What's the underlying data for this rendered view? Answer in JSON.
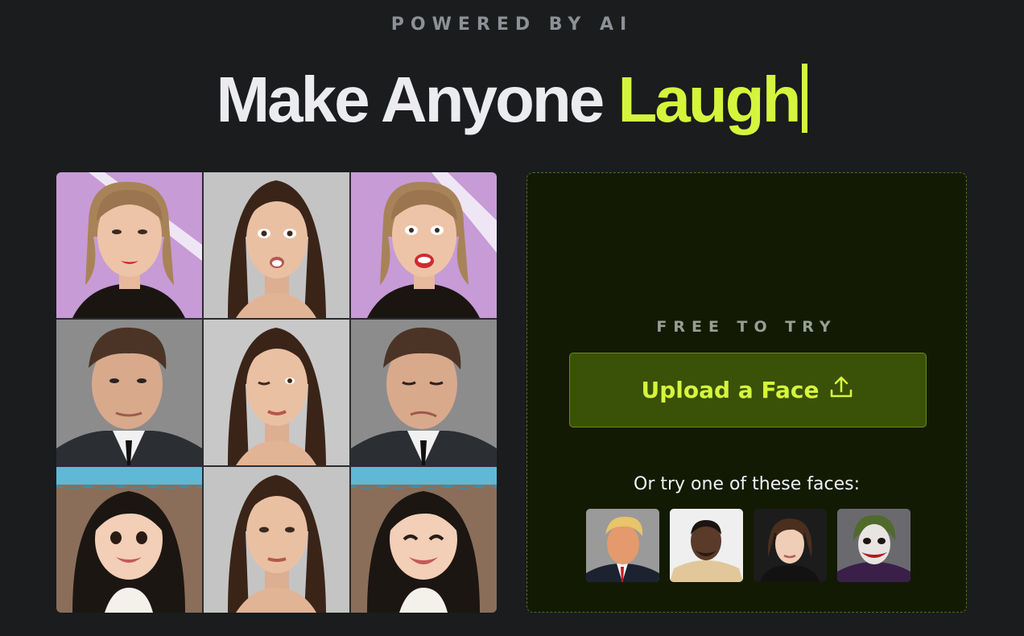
{
  "header": {
    "eyebrow": "POWERED BY AI",
    "headline_main": "Make Anyone ",
    "headline_accent": "Laugh"
  },
  "gallery": {
    "tiles": [
      {
        "name": "blonde-woman-neutral"
      },
      {
        "name": "brunette-woman-surprised"
      },
      {
        "name": "blonde-woman-shocked"
      },
      {
        "name": "man-in-suit-neutral"
      },
      {
        "name": "brunette-woman-winking"
      },
      {
        "name": "man-in-suit-winking"
      },
      {
        "name": "cartoon-girl-smiling"
      },
      {
        "name": "brunette-woman-neutral"
      },
      {
        "name": "cartoon-girl-smiling-2"
      }
    ]
  },
  "panel": {
    "free_label": "FREE TO TRY",
    "upload_label": "Upload a Face",
    "try_label": "Or try one of these faces:",
    "sample_faces": [
      {
        "name": "sample-face-1"
      },
      {
        "name": "sample-face-2"
      },
      {
        "name": "sample-face-3"
      },
      {
        "name": "sample-face-4"
      }
    ]
  },
  "colors": {
    "accent": "#d4f53c",
    "background": "#1a1c1e",
    "panel": "#131a03",
    "button": "#3a5108"
  }
}
